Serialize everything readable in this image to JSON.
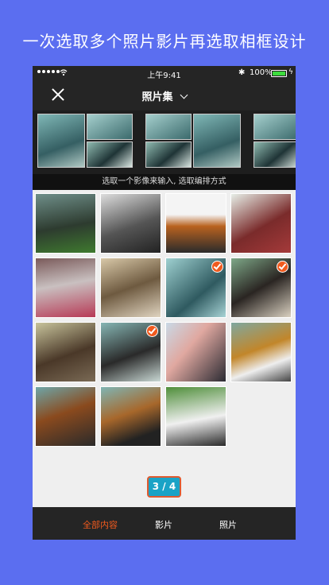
{
  "headline": "一次选取多个照片影片再选取相框设计",
  "status_bar": {
    "time": "上午9:41",
    "battery": "100%",
    "bluetooth_glyph": "✱",
    "bolt_glyph": "ϟ"
  },
  "nav": {
    "title": "照片集",
    "close_icon": "close-icon",
    "dropdown_icon": "chevron-down-icon"
  },
  "hint": "选取一个影像来输入, 选取编排方式",
  "counter": "3 / 4",
  "tabs": [
    {
      "label": "全部内容",
      "active": true
    },
    {
      "label": "影片",
      "active": false
    },
    {
      "label": "照片",
      "active": false
    }
  ],
  "colors": {
    "background": "#5b6ef0",
    "accent": "#f05a1e",
    "counter": "#1aa3c6",
    "bar": "#252525"
  },
  "photos": [
    {
      "selected": false
    },
    {
      "selected": false
    },
    {
      "selected": false
    },
    {
      "selected": false
    },
    {
      "selected": false
    },
    {
      "selected": false
    },
    {
      "selected": true
    },
    {
      "selected": true
    },
    {
      "selected": false
    },
    {
      "selected": true
    },
    {
      "selected": false
    },
    {
      "selected": false
    },
    {
      "selected": false
    },
    {
      "selected": false
    },
    {
      "selected": false
    }
  ]
}
